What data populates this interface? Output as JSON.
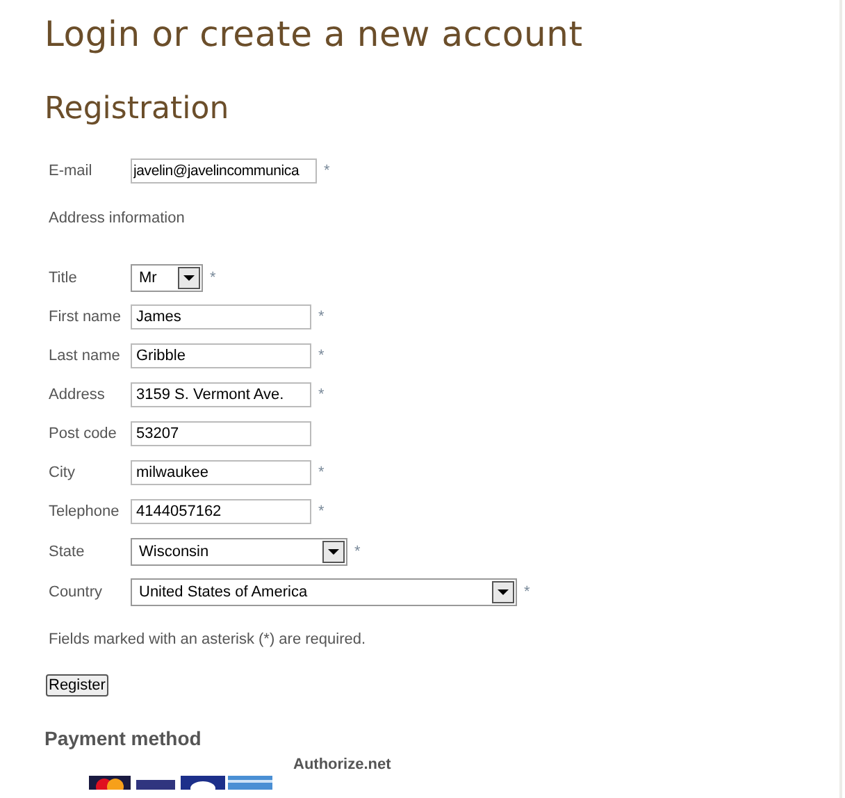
{
  "page_title": "Login or create a new account",
  "section_title": "Registration",
  "email": {
    "label": "E-mail",
    "value": "javelin@javelincommunica",
    "required": true
  },
  "address_heading": "Address information",
  "fields": [
    {
      "label": "Title",
      "kind": "select",
      "value": "Mr",
      "required": true
    },
    {
      "label": "First name",
      "kind": "input",
      "value": "James",
      "required": true
    },
    {
      "label": "Last name",
      "kind": "input",
      "value": "Gribble",
      "required": true
    },
    {
      "label": "Address",
      "kind": "input",
      "value": "3159 S. Vermont Ave.",
      "required": true
    },
    {
      "label": "Post code",
      "kind": "input",
      "value": "53207",
      "required": false
    },
    {
      "label": "City",
      "kind": "input",
      "value": "milwaukee",
      "required": true
    },
    {
      "label": "Telephone",
      "kind": "input",
      "value": "4144057162",
      "required": true
    },
    {
      "label": "State",
      "kind": "select",
      "value": "Wisconsin",
      "required": true
    },
    {
      "label": "Country",
      "kind": "select",
      "value": "United States of America",
      "required": true
    }
  ],
  "required_note": "Fields marked with an asterisk (*) are required.",
  "asterisk": "*",
  "register_button": "Register",
  "payment": {
    "title": "Payment method",
    "provider": "Authorize.net"
  }
}
